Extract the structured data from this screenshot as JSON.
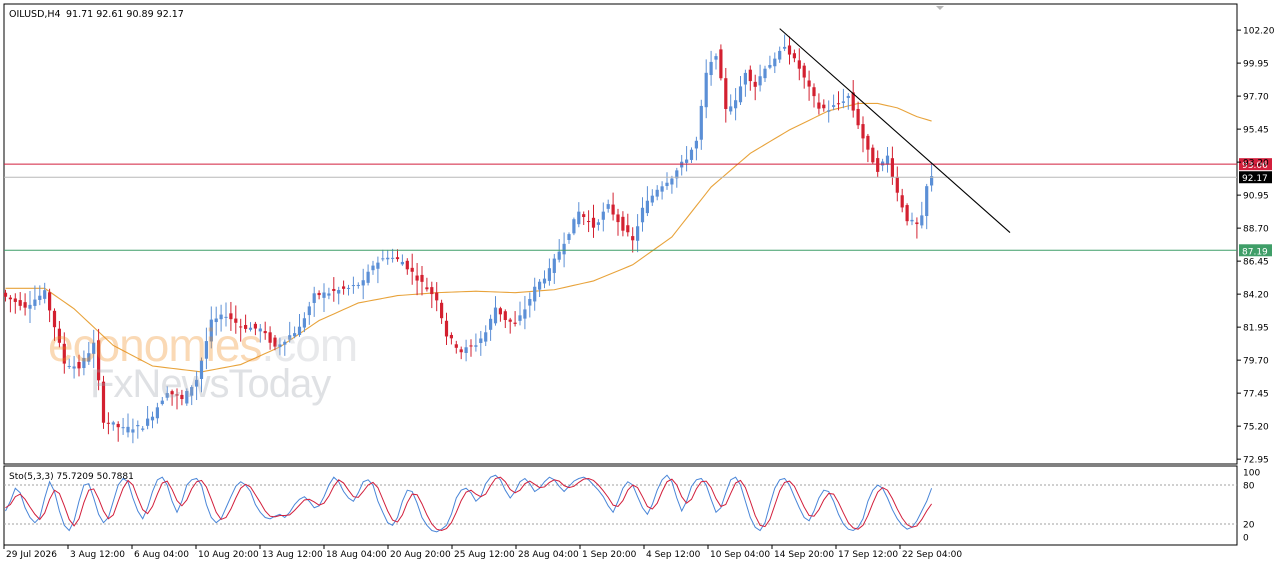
{
  "chart_header": {
    "symbol": "OILUSD,H4",
    "ohlc": "91.71 92.61 90.89 92.17"
  },
  "watermark": {
    "line1_part1": "econo",
    "line1_part2": "mies",
    "line1_part3": ".com",
    "line2": "FxNewsToday"
  },
  "colors": {
    "bull": "#5b8fd6",
    "bear": "#d32030",
    "ma": "#e8a33b",
    "resistance": "#d21f3c",
    "support": "#3f9e68",
    "trendline": "#000000",
    "stoch_main": "#4a86d8",
    "stoch_signal": "#d21f3c"
  },
  "chart_data": [
    {
      "type": "candlestick",
      "y_ticks": [
        "102.20",
        "99.95",
        "97.70",
        "95.45",
        "93.20",
        "90.95",
        "88.70",
        "86.45",
        "84.20",
        "81.95",
        "79.70",
        "77.45",
        "75.20",
        "72.95"
      ],
      "ylim": [
        72.62,
        103.98
      ],
      "x_tick_labels": [
        "29 Jul 2026",
        "3 Aug 12:00",
        "6 Aug 04:00",
        "10 Aug 20:00",
        "13 Aug 12:00",
        "18 Aug 04:00",
        "20 Aug 20:00",
        "25 Aug 12:00",
        "28 Aug 04:00",
        "1 Sep 20:00",
        "4 Sep 12:00",
        "10 Sep 04:00",
        "14 Sep 20:00",
        "17 Sep 12:00",
        "22 Sep 04:00"
      ],
      "current_price": {
        "value": 92.17,
        "label": "92.17"
      },
      "horizontal_lines": [
        {
          "name": "resistance",
          "value": 93.06,
          "label": "93.06"
        },
        {
          "name": "support",
          "value": 87.19,
          "label": "87.19"
        }
      ],
      "trendline": {
        "from_bar": 158,
        "from_value": 102.3,
        "to_bar": 205,
        "to_value": 88.4
      },
      "close_anchors": [
        [
          0,
          84.0
        ],
        [
          4,
          83.4
        ],
        [
          8,
          84.3
        ],
        [
          10,
          82.0
        ],
        [
          12,
          79.5
        ],
        [
          15,
          79.2
        ],
        [
          18,
          80.8
        ],
        [
          20,
          75.6
        ],
        [
          24,
          75.0
        ],
        [
          28,
          75.2
        ],
        [
          30,
          76.0
        ],
        [
          33,
          77.6
        ],
        [
          36,
          77.0
        ],
        [
          39,
          78.4
        ],
        [
          42,
          82.3
        ],
        [
          45,
          82.8
        ],
        [
          48,
          82.0
        ],
        [
          52,
          81.8
        ],
        [
          55,
          80.6
        ],
        [
          60,
          81.9
        ],
        [
          63,
          84.1
        ],
        [
          66,
          84.3
        ],
        [
          70,
          84.6
        ],
        [
          73,
          85.0
        ],
        [
          75,
          86.2
        ],
        [
          78,
          86.8
        ],
        [
          81,
          86.4
        ],
        [
          84,
          85.3
        ],
        [
          86,
          84.6
        ],
        [
          88,
          83.9
        ],
        [
          90,
          81.4
        ],
        [
          93,
          80.3
        ],
        [
          96,
          80.8
        ],
        [
          98,
          81.6
        ],
        [
          100,
          83.3
        ],
        [
          102,
          82.5
        ],
        [
          104,
          82.1
        ],
        [
          106,
          83.2
        ],
        [
          108,
          84.6
        ],
        [
          111,
          85.8
        ],
        [
          114,
          87.8
        ],
        [
          117,
          89.8
        ],
        [
          120,
          88.8
        ],
        [
          123,
          90.2
        ],
        [
          126,
          88.7
        ],
        [
          128,
          87.8
        ],
        [
          130,
          90.0
        ],
        [
          133,
          91.4
        ],
        [
          136,
          92.2
        ],
        [
          139,
          93.5
        ],
        [
          141,
          94.6
        ],
        [
          143,
          99.2
        ],
        [
          145,
          100.6
        ],
        [
          147,
          96.9
        ],
        [
          149,
          97.3
        ],
        [
          151,
          99.4
        ],
        [
          153,
          98.4
        ],
        [
          155,
          99.7
        ],
        [
          157,
          100.1
        ],
        [
          159,
          101.2
        ],
        [
          162,
          99.6
        ],
        [
          164,
          98.2
        ],
        [
          166,
          96.9
        ],
        [
          168,
          96.8
        ],
        [
          170,
          97.2
        ],
        [
          172,
          97.7
        ],
        [
          174,
          95.8
        ],
        [
          176,
          93.9
        ],
        [
          178,
          92.7
        ],
        [
          180,
          93.6
        ],
        [
          182,
          91.1
        ],
        [
          184,
          89.3
        ],
        [
          186,
          88.9
        ],
        [
          187,
          89.4
        ],
        [
          188,
          91.5
        ],
        [
          189,
          92.17
        ]
      ],
      "moving_average_anchors": [
        [
          0,
          84.6
        ],
        [
          8,
          84.6
        ],
        [
          14,
          83.2
        ],
        [
          22,
          80.7
        ],
        [
          30,
          79.3
        ],
        [
          40,
          78.9
        ],
        [
          48,
          79.4
        ],
        [
          56,
          80.6
        ],
        [
          64,
          82.4
        ],
        [
          72,
          83.6
        ],
        [
          80,
          84.1
        ],
        [
          88,
          84.3
        ],
        [
          96,
          84.4
        ],
        [
          104,
          84.3
        ],
        [
          112,
          84.5
        ],
        [
          120,
          85.1
        ],
        [
          128,
          86.2
        ],
        [
          136,
          88.1
        ],
        [
          144,
          91.5
        ],
        [
          152,
          93.8
        ],
        [
          160,
          95.4
        ],
        [
          168,
          96.7
        ],
        [
          174,
          97.2
        ],
        [
          178,
          97.2
        ],
        [
          182,
          96.9
        ],
        [
          186,
          96.3
        ],
        [
          189,
          96.0
        ]
      ]
    },
    {
      "type": "line",
      "title": "Sto(5,3,3) 75.7209 50.7881",
      "y_ticks": [
        "100",
        "80",
        "20",
        "0"
      ],
      "levels": [
        80,
        20
      ],
      "ylim": [
        0,
        100
      ],
      "series": [
        {
          "name": "main",
          "values": [
            40,
            55,
            75,
            68,
            45,
            30,
            22,
            30,
            60,
            85,
            70,
            40,
            18,
            10,
            25,
            55,
            80,
            82,
            60,
            35,
            22,
            30,
            55,
            80,
            90,
            85,
            60,
            40,
            28,
            45,
            70,
            88,
            92,
            80,
            55,
            38,
            55,
            80,
            88,
            90,
            80,
            50,
            30,
            22,
            28,
            45,
            62,
            78,
            85,
            80,
            70,
            50,
            38,
            30,
            28,
            32,
            35,
            30,
            38,
            50,
            58,
            62,
            55,
            45,
            48,
            62,
            80,
            92,
            85,
            70,
            60,
            55,
            68,
            85,
            88,
            80,
            55,
            38,
            22,
            18,
            30,
            55,
            72,
            70,
            52,
            30,
            18,
            10,
            8,
            12,
            18,
            35,
            60,
            72,
            75,
            68,
            55,
            62,
            82,
            92,
            95,
            88,
            72,
            60,
            70,
            85,
            90,
            82,
            70,
            75,
            85,
            92,
            88,
            78,
            70,
            78,
            86,
            90,
            92,
            88,
            80,
            72,
            62,
            48,
            38,
            55,
            75,
            85,
            80,
            62,
            45,
            35,
            50,
            72,
            88,
            95,
            85,
            60,
            40,
            55,
            78,
            88,
            90,
            80,
            58,
            38,
            45,
            68,
            88,
            92,
            80,
            55,
            30,
            15,
            10,
            22,
            50,
            75,
            88,
            90,
            80,
            62,
            45,
            30,
            25,
            40,
            60,
            72,
            70,
            55,
            35,
            20,
            12,
            10,
            15,
            28,
            55,
            72,
            80,
            75,
            60,
            42,
            28,
            18,
            12,
            15,
            25,
            40,
            55,
            75
          ]
        },
        {
          "name": "signal",
          "values": [
            45,
            50,
            62,
            66,
            58,
            46,
            35,
            27,
            37,
            58,
            72,
            67,
            48,
            27,
            17,
            28,
            53,
            72,
            74,
            59,
            40,
            28,
            34,
            55,
            75,
            87,
            80,
            60,
            42,
            36,
            47,
            66,
            83,
            86,
            73,
            56,
            48,
            57,
            74,
            85,
            87,
            77,
            58,
            38,
            27,
            30,
            43,
            60,
            75,
            81,
            77,
            65,
            53,
            40,
            32,
            31,
            33,
            33,
            34,
            41,
            49,
            57,
            58,
            54,
            49,
            52,
            63,
            78,
            88,
            83,
            72,
            62,
            61,
            70,
            80,
            84,
            76,
            58,
            40,
            26,
            23,
            34,
            53,
            66,
            65,
            51,
            34,
            20,
            12,
            10,
            13,
            22,
            38,
            56,
            69,
            72,
            66,
            62,
            66,
            79,
            90,
            92,
            85,
            73,
            68,
            72,
            82,
            86,
            81,
            76,
            77,
            84,
            88,
            86,
            79,
            76,
            78,
            84,
            89,
            90,
            87,
            80,
            71,
            61,
            49,
            47,
            56,
            72,
            80,
            76,
            62,
            47,
            43,
            52,
            70,
            85,
            89,
            80,
            62,
            52,
            58,
            74,
            85,
            86,
            76,
            59,
            47,
            50,
            67,
            83,
            87,
            76,
            55,
            33,
            18,
            16,
            27,
            49,
            71,
            84,
            86,
            78,
            62,
            46,
            33,
            32,
            42,
            57,
            67,
            66,
            53,
            37,
            22,
            14,
            12,
            18,
            33,
            52,
            69,
            76,
            72,
            59,
            43,
            29,
            19,
            15,
            17,
            27,
            40,
            51
          ]
        }
      ]
    }
  ]
}
